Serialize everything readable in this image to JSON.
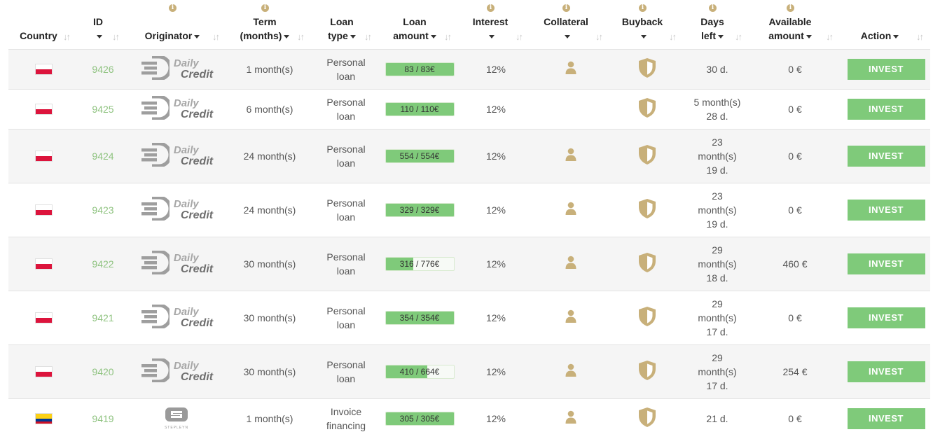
{
  "columns": {
    "country": "Country",
    "id": "ID",
    "originator": "Originator",
    "term_l1": "Term",
    "term_l2": "(months)",
    "type_l1": "Loan",
    "type_l2": "type",
    "amount_l1": "Loan",
    "amount_l2": "amount",
    "interest": "Interest",
    "collateral": "Collateral",
    "buyback": "Buyback",
    "days_l1": "Days",
    "days_l2": "left",
    "avail_l1": "Available",
    "avail_l2": "amount",
    "action": "Action"
  },
  "icons": {
    "info": "info-icon",
    "sort": "sort-icon",
    "caret": "caret-down-icon",
    "collateral": "person-icon",
    "buyback": "shield-icon"
  },
  "colors": {
    "accent_green": "#7fca7a",
    "id_green": "#8fc380",
    "gold": "#c8b07a"
  },
  "flags": {
    "pl": [
      "#ffffff",
      "#dc143c"
    ],
    "co": [
      "#fcd116",
      "#003893",
      "#ce1126"
    ]
  },
  "logos": {
    "daily_credit": {
      "line1": "Daily",
      "line2": "Credit"
    },
    "stepline": {
      "text": "STEPLEYN"
    }
  },
  "rows": [
    {
      "flag": "pl",
      "id": "9426",
      "originator": "daily_credit",
      "term": "1 month(s)",
      "type_l1": "Personal",
      "type_l2": "loan",
      "amount": "83 / 83€",
      "progress": 1.0,
      "interest": "12%",
      "collateral": true,
      "buyback": true,
      "days": [
        "30 d."
      ],
      "available": "0 €",
      "action": "INVEST"
    },
    {
      "flag": "pl",
      "id": "9425",
      "originator": "daily_credit",
      "term": "6 month(s)",
      "type_l1": "Personal",
      "type_l2": "loan",
      "amount": "110 / 110€",
      "progress": 1.0,
      "interest": "12%",
      "collateral": false,
      "buyback": true,
      "days": [
        "5 month(s)",
        "28 d."
      ],
      "available": "0 €",
      "action": "INVEST"
    },
    {
      "flag": "pl",
      "id": "9424",
      "originator": "daily_credit",
      "term": "24 month(s)",
      "type_l1": "Personal",
      "type_l2": "loan",
      "amount": "554 / 554€",
      "progress": 1.0,
      "interest": "12%",
      "collateral": true,
      "buyback": true,
      "days": [
        "23",
        "month(s)",
        "19 d."
      ],
      "available": "0 €",
      "action": "INVEST"
    },
    {
      "flag": "pl",
      "id": "9423",
      "originator": "daily_credit",
      "term": "24 month(s)",
      "type_l1": "Personal",
      "type_l2": "loan",
      "amount": "329 / 329€",
      "progress": 1.0,
      "interest": "12%",
      "collateral": true,
      "buyback": true,
      "days": [
        "23",
        "month(s)",
        "19 d."
      ],
      "available": "0 €",
      "action": "INVEST"
    },
    {
      "flag": "pl",
      "id": "9422",
      "originator": "daily_credit",
      "term": "30 month(s)",
      "type_l1": "Personal",
      "type_l2": "loan",
      "amount": "316 / 776€",
      "progress": 0.407,
      "interest": "12%",
      "collateral": true,
      "buyback": true,
      "days": [
        "29",
        "month(s)",
        "18 d."
      ],
      "available": "460 €",
      "action": "INVEST"
    },
    {
      "flag": "pl",
      "id": "9421",
      "originator": "daily_credit",
      "term": "30 month(s)",
      "type_l1": "Personal",
      "type_l2": "loan",
      "amount": "354 / 354€",
      "progress": 1.0,
      "interest": "12%",
      "collateral": true,
      "buyback": true,
      "days": [
        "29",
        "month(s)",
        "17 d."
      ],
      "available": "0 €",
      "action": "INVEST"
    },
    {
      "flag": "pl",
      "id": "9420",
      "originator": "daily_credit",
      "term": "30 month(s)",
      "type_l1": "Personal",
      "type_l2": "loan",
      "amount": "410 / 664€",
      "progress": 0.617,
      "interest": "12%",
      "collateral": true,
      "buyback": true,
      "days": [
        "29",
        "month(s)",
        "17 d."
      ],
      "available": "254 €",
      "action": "INVEST"
    },
    {
      "flag": "co",
      "id": "9419",
      "originator": "stepline",
      "term": "1 month(s)",
      "type_l1": "Invoice",
      "type_l2": "financing",
      "amount": "305 / 305€",
      "progress": 1.0,
      "interest": "12%",
      "collateral": true,
      "buyback": true,
      "days": [
        "21 d."
      ],
      "available": "0 €",
      "action": "INVEST"
    }
  ]
}
